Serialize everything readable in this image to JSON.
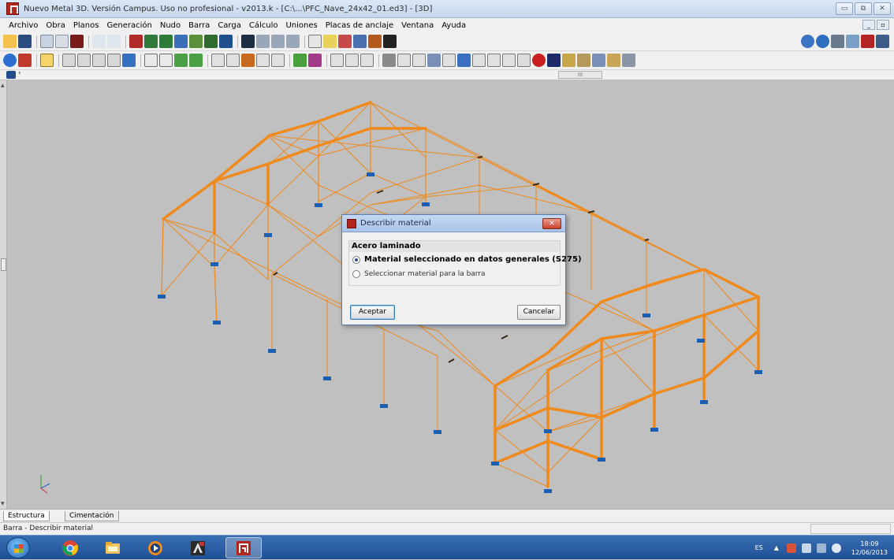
{
  "window": {
    "title": "Nuevo Metal 3D. Versión Campus. Uso no profesional - v2013.k - [C:\\...\\PFC_Nave_24x42_01.ed3] - [3D]",
    "controls": [
      "▭",
      "⧉",
      "✕"
    ]
  },
  "menu": {
    "items": [
      "Archivo",
      "Obra",
      "Planos",
      "Generación",
      "Nudo",
      "Barra",
      "Carga",
      "Cálculo",
      "Uniones",
      "Placas de anclaje",
      "Ventana",
      "Ayuda"
    ]
  },
  "scroll": {
    "thumb_label": "III"
  },
  "dialog": {
    "title": "Describir material",
    "group_title": "Acero laminado",
    "option_general": "Material seleccionado en datos generales (S275)",
    "option_bar": "Seleccionar material para la barra",
    "ok": "Aceptar",
    "cancel": "Cancelar"
  },
  "tabs": {
    "structure": "Estructura",
    "foundation": "Cimentación"
  },
  "status": {
    "text": "Barra - Describir material"
  },
  "taskbar": {
    "lang": "ES",
    "time": "18:09",
    "date": "12/06/2013"
  },
  "colors": {
    "bar_orange": "#f08a1c",
    "support_blue": "#1b5fb4",
    "canvas": "#c0c0c0"
  }
}
